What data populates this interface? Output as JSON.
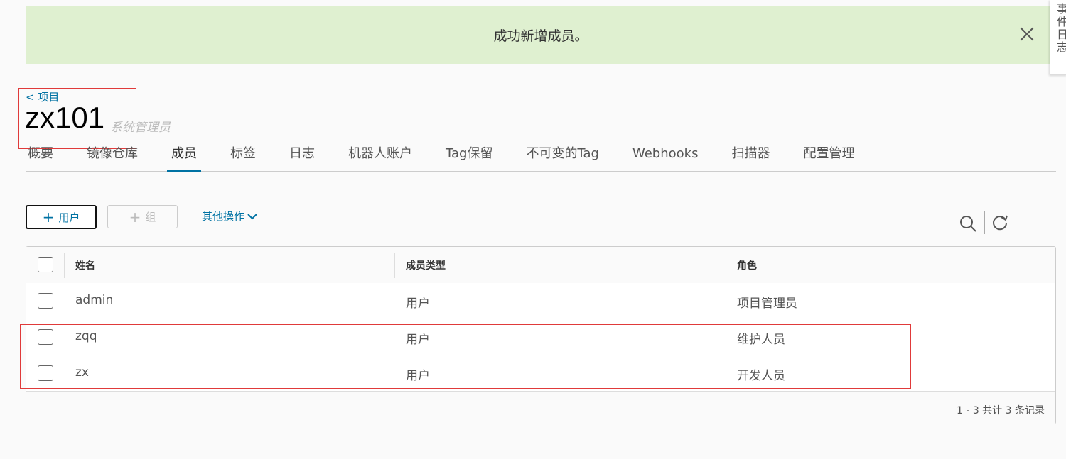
{
  "alert": {
    "message": "成功新增成员。",
    "close_icon": "close-icon"
  },
  "side_tab": {
    "label": "事件日志"
  },
  "header": {
    "back_link": "< 项目",
    "project_name": "zx101",
    "role": "系统管理员"
  },
  "tabs": [
    {
      "label": "概要"
    },
    {
      "label": "镜像仓库"
    },
    {
      "label": "成员",
      "active": true
    },
    {
      "label": "标签"
    },
    {
      "label": "日志"
    },
    {
      "label": "机器人账户"
    },
    {
      "label": "Tag保留"
    },
    {
      "label": "不可变的Tag"
    },
    {
      "label": "Webhooks"
    },
    {
      "label": "扫描器"
    },
    {
      "label": "配置管理"
    }
  ],
  "toolbar": {
    "add_user": "用户",
    "add_group": "组",
    "more_actions": "其他操作",
    "icons": [
      "search-icon",
      "refresh-icon"
    ]
  },
  "table": {
    "columns": [
      "姓名",
      "成员类型",
      "角色"
    ],
    "rows": [
      {
        "name": "admin",
        "type": "用户",
        "role": "项目管理员"
      },
      {
        "name": "zqq",
        "type": "用户",
        "role": "维护人员"
      },
      {
        "name": "zx",
        "type": "用户",
        "role": "开发人员"
      }
    ],
    "footer": "1 - 3 共计 3 条记录"
  },
  "colors": {
    "accent": "#0072a3",
    "alert_bg": "#dff0d0",
    "highlight": "#e03a3a"
  }
}
